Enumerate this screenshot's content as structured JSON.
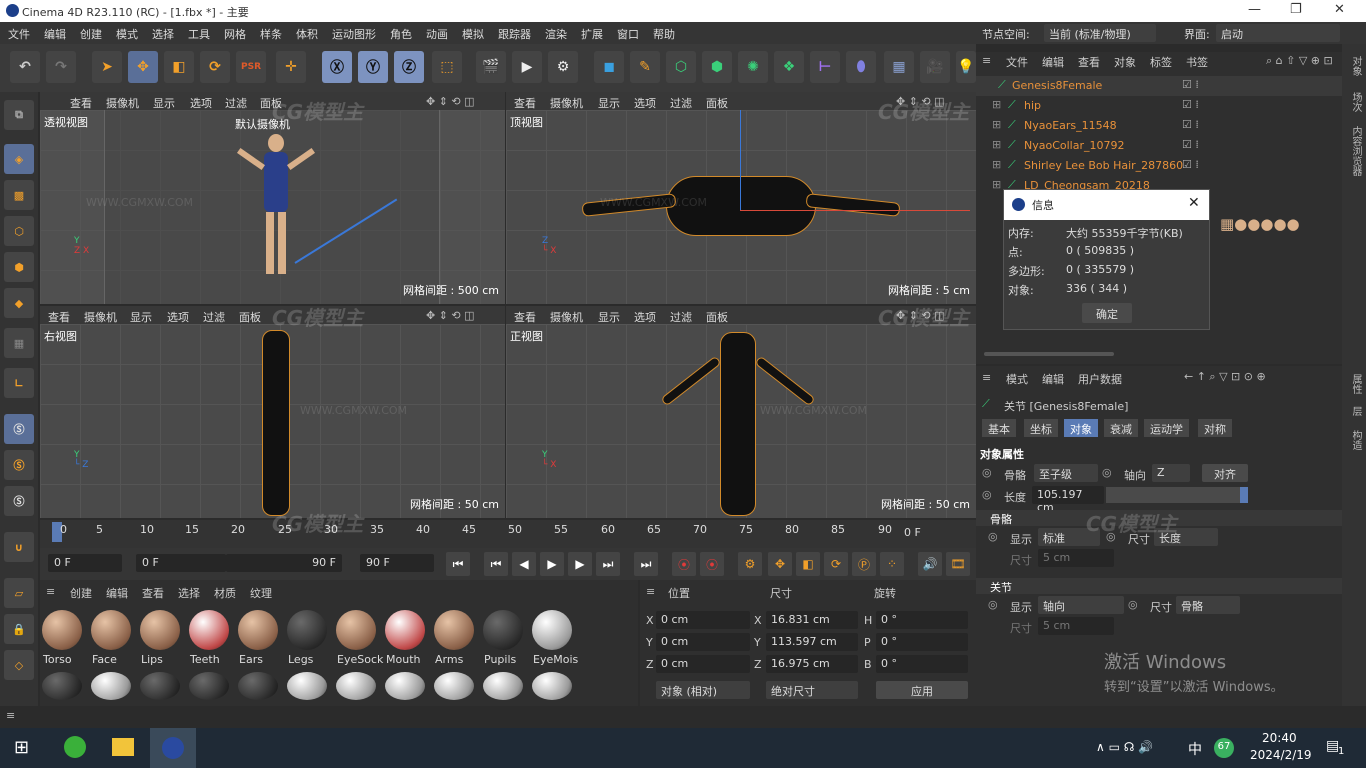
{
  "title": "Cinema 4D R23.110 (RC) - [1.fbx *] - 主要",
  "menu": [
    "文件",
    "编辑",
    "创建",
    "模式",
    "选择",
    "工具",
    "网格",
    "样条",
    "体积",
    "运动图形",
    "角色",
    "动画",
    "模拟",
    "跟踪器",
    "渲染",
    "扩展",
    "窗口",
    "帮助"
  ],
  "node_space_label": "节点空间:",
  "node_space_value": "当前 (标准/物理)",
  "interface_label": "界面:",
  "interface_value": "启动",
  "viewport_menu": [
    "查看",
    "摄像机",
    "显示",
    "选项",
    "过滤",
    "面板"
  ],
  "viewports": {
    "perspective": {
      "name": "透视视图",
      "camera": "默认摄像机",
      "grid": "网格间距 : 500 cm"
    },
    "top": {
      "name": "顶视图",
      "grid": "网格间距 : 5 cm"
    },
    "right": {
      "name": "右视图",
      "grid": "网格间距 : 50 cm"
    },
    "front": {
      "name": "正视图",
      "grid": "网格间距 : 50 cm"
    }
  },
  "timeline": {
    "ticks": [
      "0",
      "5",
      "10",
      "15",
      "20",
      "25",
      "30",
      "35",
      "40",
      "45",
      "50",
      "55",
      "60",
      "65",
      "70",
      "75",
      "80",
      "85",
      "90"
    ],
    "end_label": "0 F"
  },
  "playbar": {
    "current": "0 F",
    "start": "0 F",
    "end": "90 F",
    "max": "90 F"
  },
  "materials": {
    "menu": [
      "创建",
      "编辑",
      "查看",
      "选择",
      "材质",
      "纹理"
    ],
    "items": [
      "Torso",
      "Face",
      "Lips",
      "Teeth",
      "Ears",
      "Legs",
      "EyeSock",
      "Mouth",
      "Arms",
      "Pupils",
      "EyeMois"
    ]
  },
  "coords": {
    "headers": [
      "位置",
      "尺寸",
      "旋转"
    ],
    "rows": [
      {
        "axis": "X",
        "pos": "0 cm",
        "size_axis": "X",
        "size": "16.831 cm",
        "rot_axis": "H",
        "rot": "0 °"
      },
      {
        "axis": "Y",
        "pos": "0 cm",
        "size_axis": "Y",
        "size": "113.597 cm",
        "rot_axis": "P",
        "rot": "0 °"
      },
      {
        "axis": "Z",
        "pos": "0 cm",
        "size_axis": "Z",
        "size": "16.975 cm",
        "rot_axis": "B",
        "rot": "0 °"
      }
    ],
    "mode": "对象 (相对)",
    "size_mode": "绝对尺寸",
    "apply": "应用"
  },
  "objects": {
    "menu": [
      "文件",
      "编辑",
      "查看",
      "对象",
      "标签",
      "书签"
    ],
    "items": [
      "Genesis8Female",
      "hip",
      "NyaoEars_11548",
      "NyaoCollar_10792",
      "Shirley Lee Bob Hair_287860",
      "LD_Cheongsam_20218"
    ]
  },
  "dialog": {
    "title": "信息",
    "rows": [
      {
        "label": "内存:",
        "value": "大约 55359千字节(KB)"
      },
      {
        "label": "点:",
        "value": "0 ( 509835 )"
      },
      {
        "label": "多边形:",
        "value": "0 ( 335579 )"
      },
      {
        "label": "对象:",
        "value": "336 ( 344 )"
      }
    ],
    "ok": "确定"
  },
  "attributes": {
    "menu": [
      "模式",
      "编辑",
      "用户数据"
    ],
    "title": "关节 [Genesis8Female]",
    "tabs": [
      "基本",
      "坐标",
      "对象",
      "衰减",
      "运动学",
      "对称"
    ],
    "section": "对象属性",
    "bone_label": "骨骼",
    "bone_value": "至子级",
    "axis_label": "轴向",
    "axis_value": "Z",
    "align": "对齐",
    "length_label": "长度",
    "length_value": "105.197 cm",
    "bones_group": "骨骼",
    "display_label": "显示",
    "display_value": "标准",
    "size_label": "尺寸",
    "size_value": "长度",
    "size_sub_label": "尺寸",
    "size_sub_value": "5 cm",
    "joints_group": "关节",
    "j_display_value": "轴向",
    "j_size_value": "骨骼",
    "j_size_sub_value": "5 cm"
  },
  "right_strip": [
    "对象",
    "场次",
    "内容浏览器",
    "属性",
    "层",
    "构造"
  ],
  "activate": {
    "line1": "激活 Windows",
    "line2": "转到“设置”以激活 Windows。"
  },
  "taskbar": {
    "time": "20:40",
    "date": "2024/2/19",
    "ime": "中",
    "badge": "67",
    "notif": "1"
  },
  "watermark": {
    "logo": "CG模型主",
    "url": "WWW.CGMXW.COM"
  }
}
